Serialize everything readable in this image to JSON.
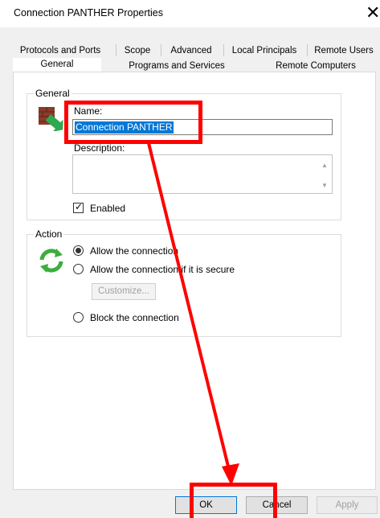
{
  "window": {
    "title": "Connection PANTHER Properties",
    "close_glyph": "✕"
  },
  "tabs_row1": [
    {
      "label": "Protocols and Ports"
    },
    {
      "label": "Scope"
    },
    {
      "label": "Advanced"
    },
    {
      "label": "Local Principals"
    },
    {
      "label": "Remote Users"
    }
  ],
  "tabs_row2": [
    {
      "label": "General",
      "selected": true
    },
    {
      "label": "Programs and Services"
    },
    {
      "label": "Remote Computers"
    }
  ],
  "general": {
    "legend": "General",
    "name_label": "Name:",
    "name_value": "Connection PANTHER",
    "description_label": "Description:",
    "description_value": "",
    "enabled_label": "Enabled",
    "enabled_checked": true,
    "icon": "firewall-rule-icon"
  },
  "action": {
    "legend": "Action",
    "icon": "refresh-arrows-icon",
    "options": [
      {
        "label": "Allow the connection",
        "selected": true
      },
      {
        "label": "Allow the connection if it is secure",
        "selected": false
      },
      {
        "label": "Block the connection",
        "selected": false
      }
    ],
    "customize_label": "Customize..."
  },
  "buttons": {
    "ok": "OK",
    "cancel": "Cancel",
    "apply": "Apply"
  },
  "annotation_color": "#ff0000"
}
